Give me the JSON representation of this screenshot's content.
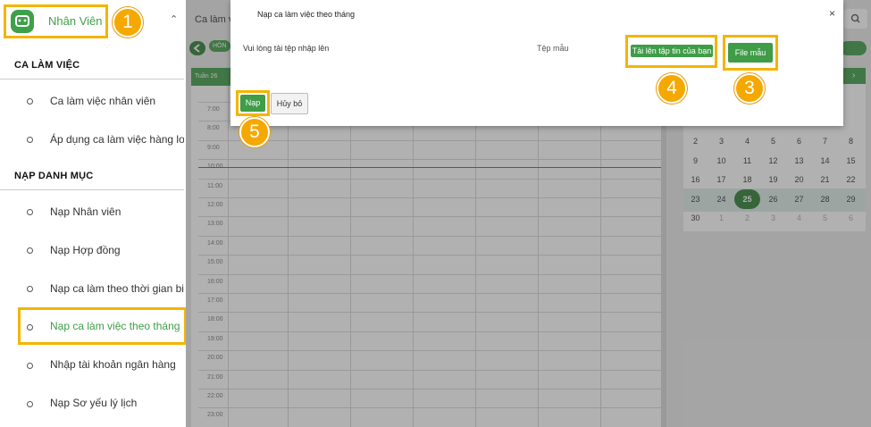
{
  "sidebar": {
    "brand_label": "Nhân Viên",
    "section1_title": "CA LÀM VIỆC",
    "section1_items": [
      "Ca làm việc nhân viên",
      "Áp dụng ca làm việc hàng loạt"
    ],
    "section2_title": "NẠP DANH MỤC",
    "section2_items": [
      "Nạp Nhân viên",
      "Nạp Hợp đồng",
      "Nạp ca làm theo thời gian biểu",
      "Nạp ca làm việc theo tháng",
      "Nhập tài khoản ngân hàng",
      "Nạp Sơ yếu lý lịch"
    ]
  },
  "background": {
    "header_title": "Ca làm v",
    "home_btn": "HÔN",
    "week_label": "Tuần 26",
    "hours": [
      "7:00",
      "8:00",
      "9:00",
      "10:00",
      "11:00",
      "12:00",
      "13:00",
      "14:00",
      "15:00",
      "16:00",
      "17:00",
      "18:00",
      "19:00",
      "20:00",
      "21:00",
      "22:00",
      "23:00"
    ],
    "calendar_rows": [
      [
        "2",
        "3",
        "4",
        "5",
        "6",
        "7",
        "8"
      ],
      [
        "9",
        "10",
        "11",
        "12",
        "13",
        "14",
        "15"
      ],
      [
        "16",
        "17",
        "18",
        "19",
        "20",
        "21",
        "22"
      ],
      [
        "23",
        "24",
        "25",
        "26",
        "27",
        "28",
        "29"
      ],
      [
        "30",
        "1",
        "2",
        "3",
        "4",
        "5",
        "6"
      ]
    ],
    "calendar_selected": "25"
  },
  "modal": {
    "title": "Nạp ca làm việc theo tháng",
    "close": "×",
    "prompt": "Vui lòng tải tệp nhập lên",
    "sample_label": "Tệp mẫu",
    "upload_btn": "Tải lên tập tin của bạn",
    "sample_btn": "File mẫu",
    "submit_btn": "Nạp",
    "cancel_btn": "Hủy bỏ"
  },
  "steps": [
    "1",
    "2",
    "3",
    "4",
    "5"
  ],
  "colors": {
    "accent": "#3f9c47",
    "highlight": "#f5b400",
    "badge": "#f5a800"
  }
}
